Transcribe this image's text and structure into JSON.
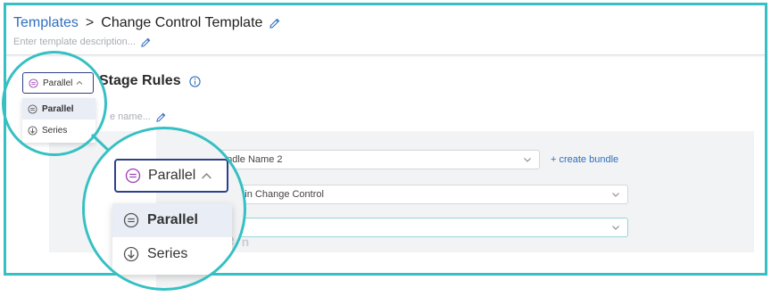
{
  "header": {
    "breadcrumb_root": "Templates",
    "breadcrumb_separator": ">",
    "title": "Change Control Template",
    "description_placeholder": "Enter template description..."
  },
  "stage": {
    "title": "Stage Rules",
    "name_placeholder_partial": "e name..."
  },
  "rules": {
    "bundle_select": "undle Name 2",
    "services_select": "rices in Change Control",
    "third_select": "es",
    "create_bundle_label": "+ create bundle",
    "ghost_label": "e n"
  },
  "mode_dropdown": {
    "selected": "Parallel",
    "options": [
      {
        "label": "Parallel",
        "icon": "parallel-icon",
        "active": true
      },
      {
        "label": "Series",
        "icon": "series-down-arrow-icon",
        "active": false
      }
    ]
  },
  "magnified": {
    "ghost_label": "e r"
  },
  "colors": {
    "accent_teal": "#36c0c4",
    "link_blue": "#2f6fbe",
    "parallel_purple": "#9b3fb5",
    "dropdown_border": "#2f3f8a"
  }
}
